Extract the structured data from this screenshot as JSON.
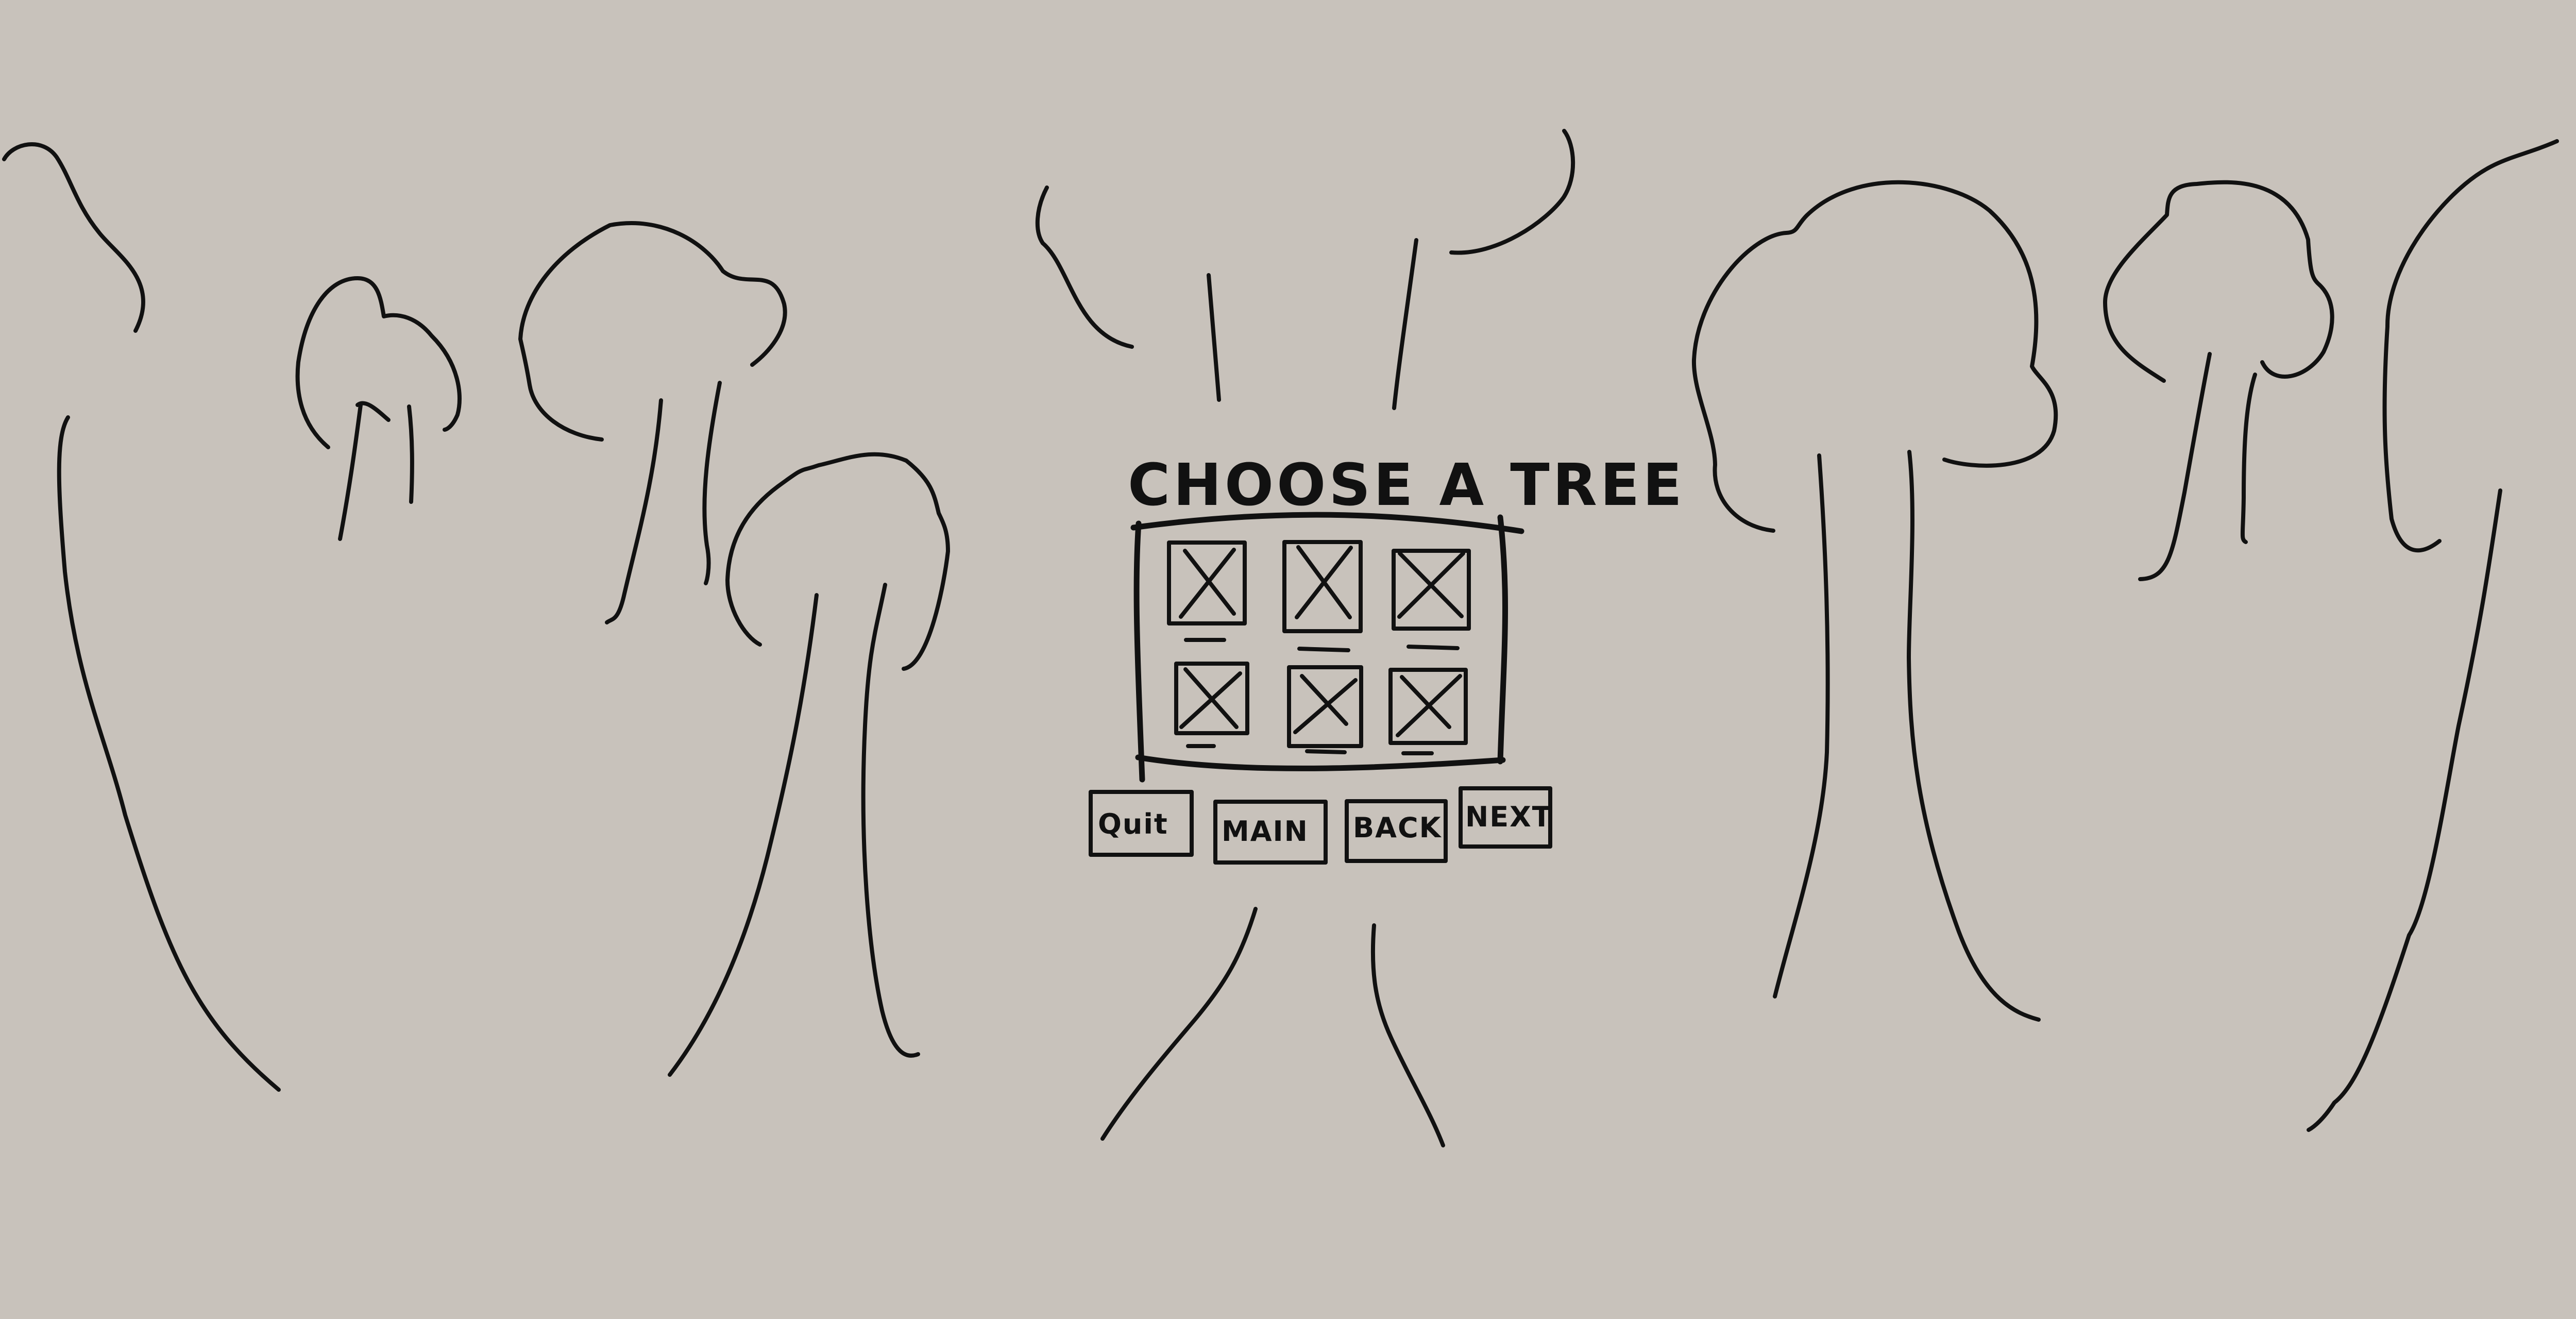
{
  "screen": {
    "title": "CHOOSE A TREE",
    "buttons": {
      "quit": "Quit",
      "main": "MAIN",
      "back": "BACK",
      "next": "NEXT"
    },
    "tree_options": [
      {
        "label": ""
      },
      {
        "label": ""
      },
      {
        "label": ""
      },
      {
        "label": ""
      },
      {
        "label": ""
      },
      {
        "label": ""
      }
    ]
  },
  "colors": {
    "background": "#c8c2bb",
    "ink": "#111111"
  },
  "icons": {
    "placeholder_image": "x-placeholder-icon"
  }
}
